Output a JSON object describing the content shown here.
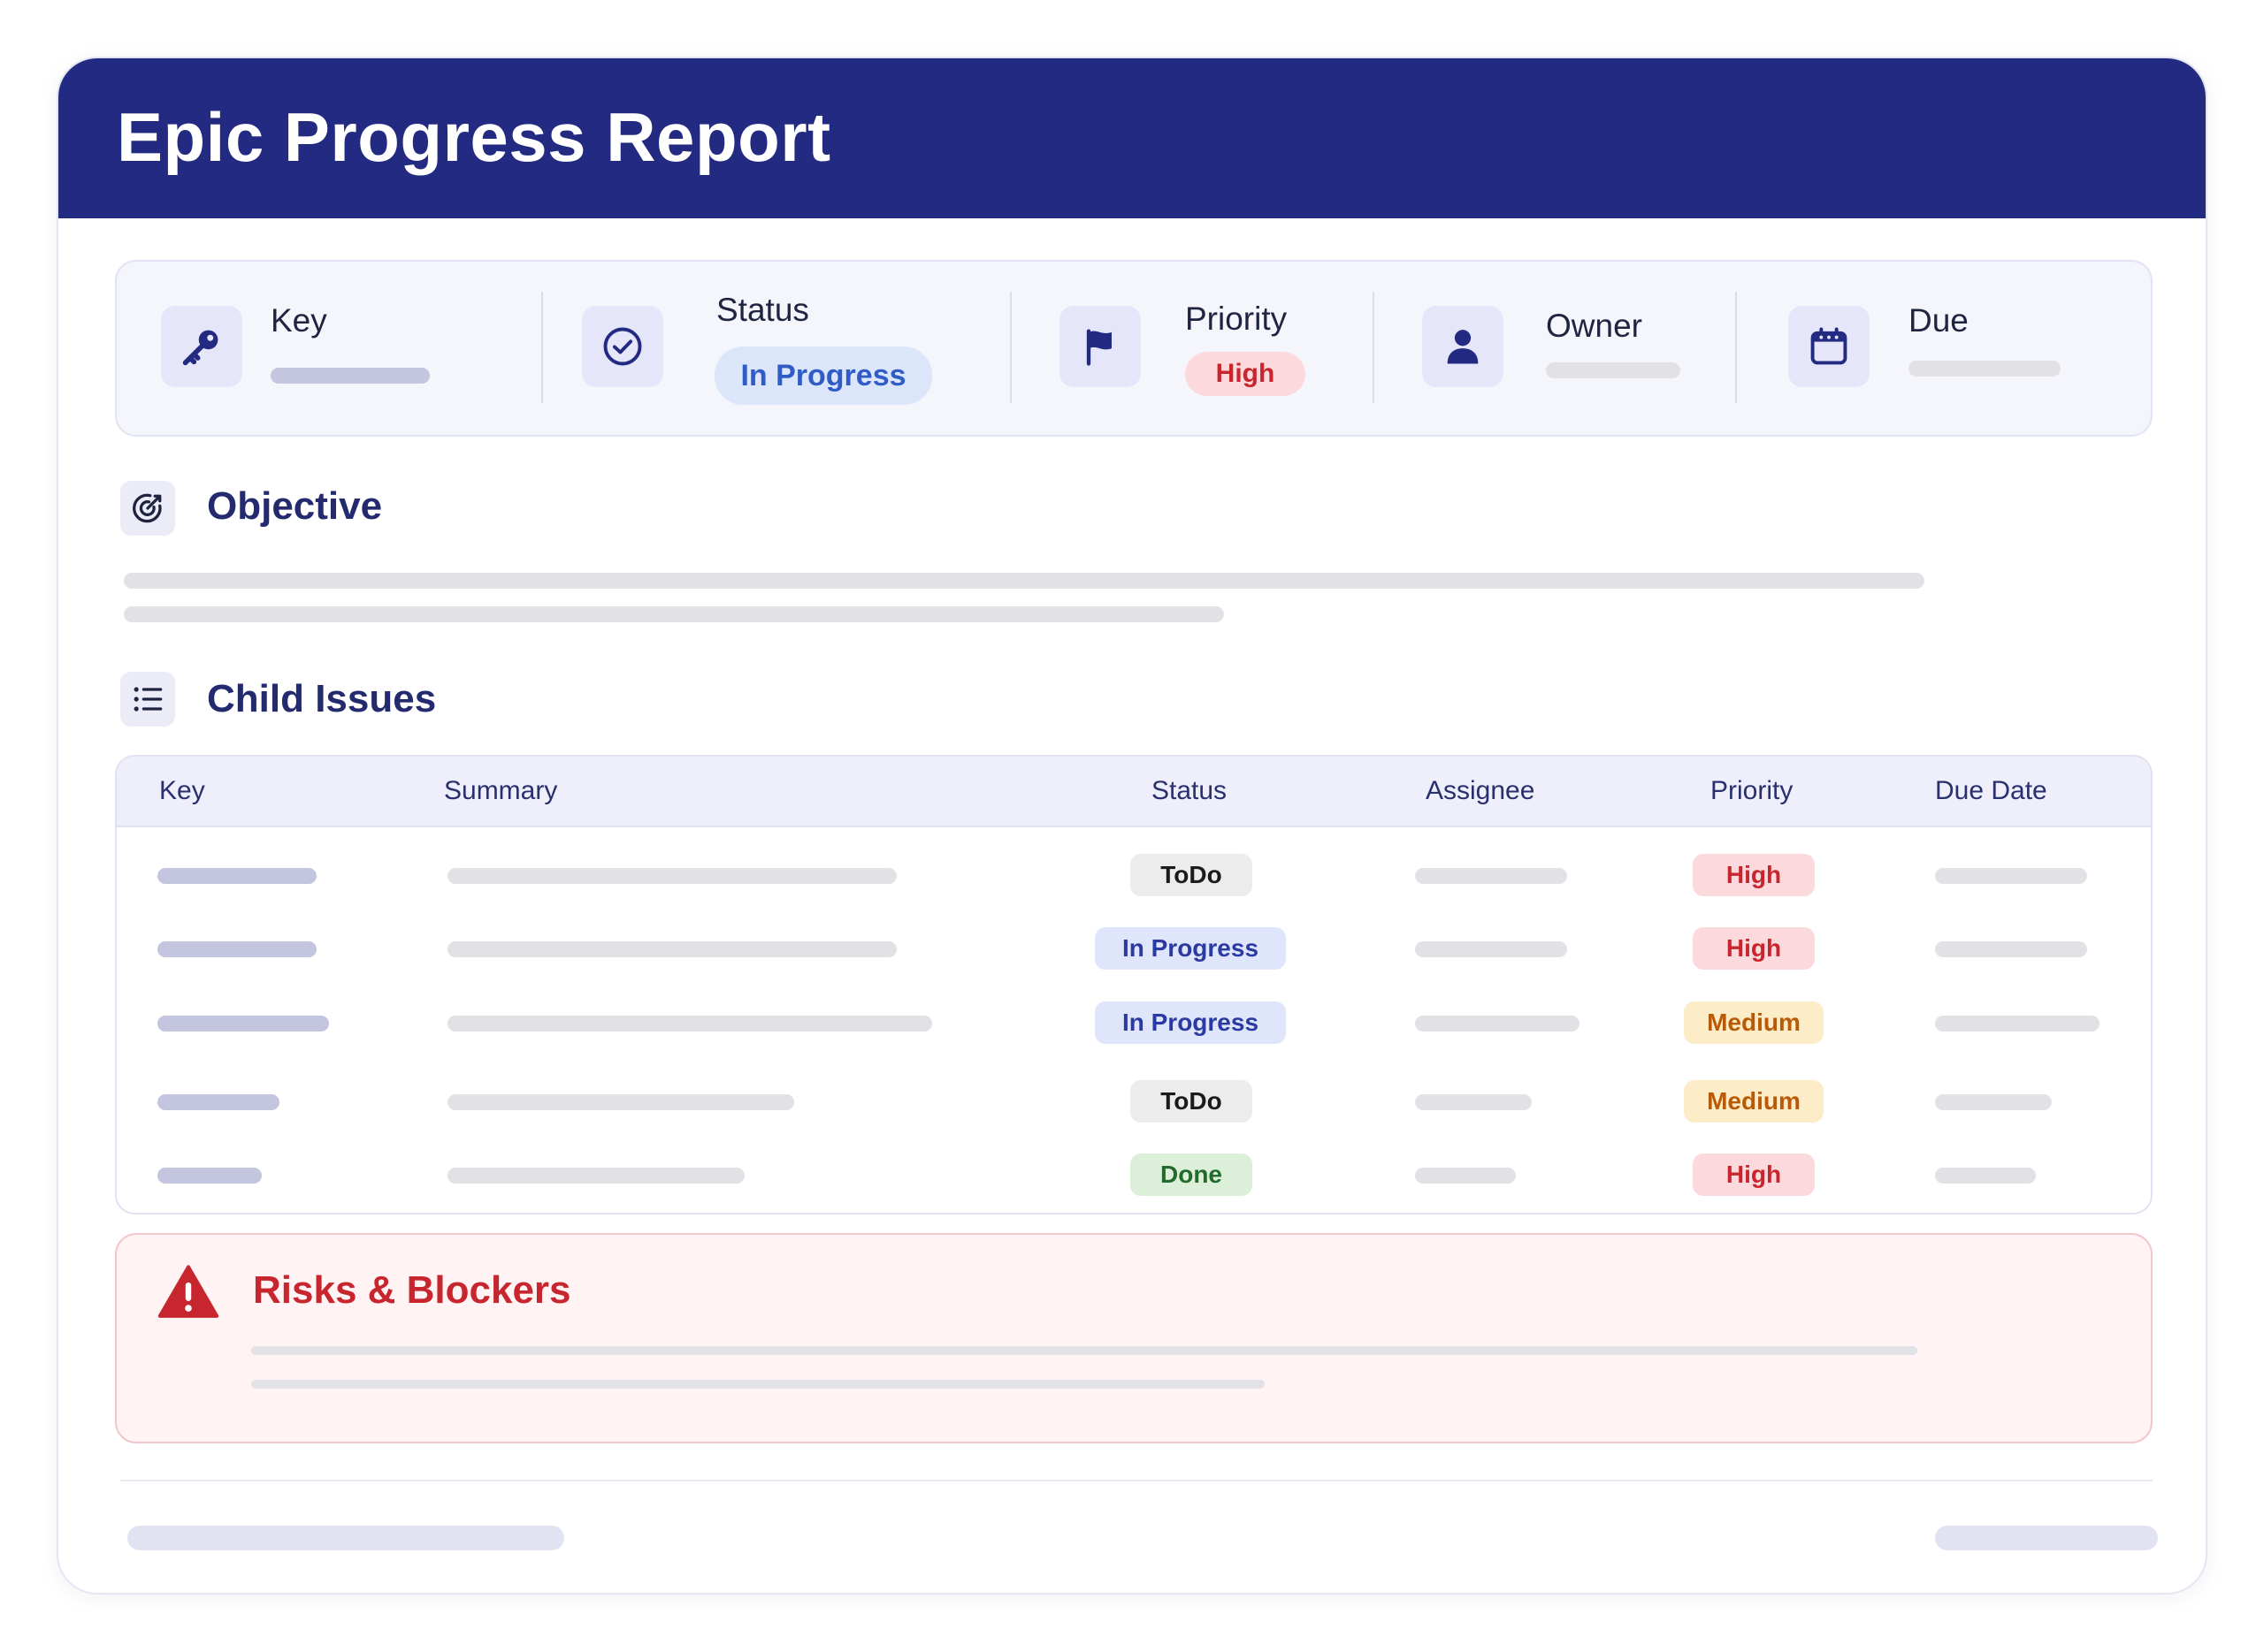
{
  "report": {
    "title": "Epic Progress Report"
  },
  "meta": {
    "key": {
      "label": "Key",
      "icon": "key-icon"
    },
    "status": {
      "label": "Status",
      "value": "In Progress",
      "icon": "check-circle-icon"
    },
    "priority": {
      "label": "Priority",
      "value": "High",
      "icon": "flag-icon"
    },
    "owner": {
      "label": "Owner",
      "icon": "user-icon"
    },
    "due": {
      "label": "Due",
      "icon": "calendar-icon"
    }
  },
  "objective": {
    "title": "Objective",
    "icon": "target-icon"
  },
  "child_issues": {
    "title": "Child Issues",
    "icon": "list-icon",
    "columns": [
      "Key",
      "Summary",
      "Status",
      "Assignee",
      "Priority",
      "Due Date"
    ],
    "rows": [
      {
        "status": "ToDo",
        "priority": "High"
      },
      {
        "status": "In Progress",
        "priority": "High"
      },
      {
        "status": "In Progress",
        "priority": "Medium"
      },
      {
        "status": "ToDo",
        "priority": "Medium"
      },
      {
        "status": "Done",
        "priority": "High"
      }
    ]
  },
  "risks": {
    "title": "Risks & Blockers",
    "icon": "warning-icon"
  },
  "colors": {
    "header": "#232a82",
    "high": "#c8262f",
    "medium": "#b85a07",
    "in_progress": "#2b3aa0",
    "done": "#236b2c"
  }
}
